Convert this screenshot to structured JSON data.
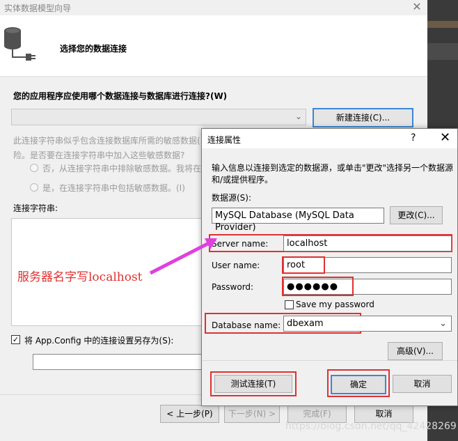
{
  "wizard": {
    "title": "实体数据模型向导",
    "close_glyph": "✕",
    "heading": "选择您的数据连接",
    "question": "您的应用程序应使用哪个数据连接与数据库进行连接?(W)",
    "connection_value": "",
    "new_connection_label": "新建连接(C)...",
    "sensitive_text_line1": "此连接字符串似乎包含连接数据库所需的敏感数据(",
    "sensitive_text_line2": "险。是否要在连接字符串中加入这些敏感数据?",
    "radio_exclude": "否，从连接字符串中排除敏感数据。我将在",
    "radio_include": "是，在连接字符串中包括敏感数据。(I)",
    "connection_string_label": "连接字符串:",
    "save_config_checked": true,
    "save_config_label": "将 App.Config 中的连接设置另存为(S):",
    "save_config_value": "",
    "buttons": {
      "prev": "< 上一步(P)",
      "next": "下一步(N) >",
      "finish": "完成(F)",
      "cancel": "取消"
    }
  },
  "dialog": {
    "title": "连接属性",
    "help_glyph": "?",
    "close_glyph": "✕",
    "intro": "输入信息以连接到选定的数据源，或单击\"更改\"选择另一个数据源和/或提供程序。",
    "datasource_label": "数据源(S):",
    "datasource_value": "MySQL Database (MySQL Data Provider)",
    "change_label": "更改(C)...",
    "server_label": "Server name:",
    "server_value": "localhost",
    "user_label": "User name:",
    "user_value": "root",
    "password_label": "Password:",
    "password_value": "●●●●●●",
    "save_password_label": "Save my password",
    "save_password_checked": false,
    "database_label": "Database name:",
    "database_value": "dbexam",
    "advanced_label": "高级(V)...",
    "test_label": "测试连接(T)",
    "ok_label": "确定",
    "cancel_label": "取消"
  },
  "annotation": {
    "text": "服务器名字写localhost",
    "color": "#e03030"
  },
  "watermark": "https://blog.csdn.net/qq_42428269",
  "colors": {
    "highlight": "#e03030",
    "arrow": "#e040e0",
    "focus": "#3b86d6"
  }
}
